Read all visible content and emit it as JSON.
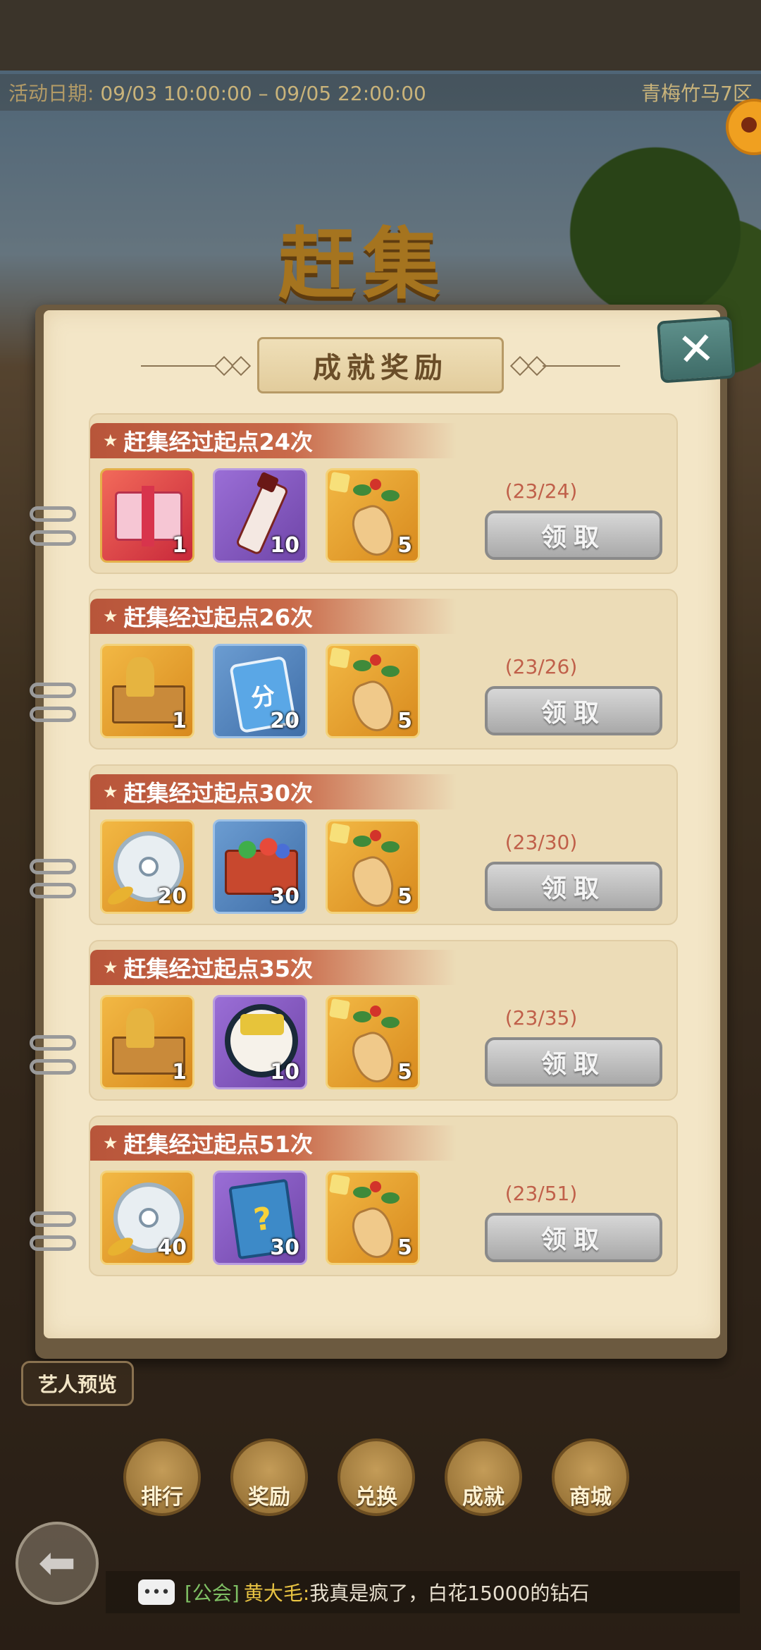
{
  "event": {
    "date_label": "活动日期:",
    "date_range": "09/03 10:00:00 – 09/05 22:00:00",
    "server": "青梅竹马7区",
    "title": "赶集"
  },
  "panel": {
    "header": "成就奖励",
    "close_label": "✕"
  },
  "achievements": [
    {
      "title": "赶集经过起点24次",
      "progress": "(23/24)",
      "claim_label": "领取",
      "rewards": [
        {
          "icon": "gift-box-icon",
          "qty": "1"
        },
        {
          "icon": "tonic-bottle-icon",
          "qty": "10"
        },
        {
          "icon": "ginseng-icon",
          "qty": "5"
        }
      ]
    },
    {
      "title": "赶集经过起点26次",
      "progress": "(23/26)",
      "claim_label": "领取",
      "rewards": [
        {
          "icon": "trophy-box-icon",
          "qty": "1"
        },
        {
          "icon": "score-card-icon",
          "qty": "20",
          "label": "分"
        },
        {
          "icon": "ginseng-icon",
          "qty": "5"
        }
      ]
    },
    {
      "title": "赶集经过起点30次",
      "progress": "(23/30)",
      "claim_label": "领取",
      "rewards": [
        {
          "icon": "jade-pendant-icon",
          "qty": "20"
        },
        {
          "icon": "treasure-chest-icon",
          "qty": "30"
        },
        {
          "icon": "ginseng-icon",
          "qty": "5"
        }
      ]
    },
    {
      "title": "赶集经过起点35次",
      "progress": "(23/35)",
      "claim_label": "领取",
      "rewards": [
        {
          "icon": "trophy-box-icon",
          "qty": "1"
        },
        {
          "icon": "cream-jar-icon",
          "qty": "10"
        },
        {
          "icon": "ginseng-icon",
          "qty": "5"
        }
      ]
    },
    {
      "title": "赶集经过起点51次",
      "progress": "(23/51)",
      "claim_label": "领取",
      "rewards": [
        {
          "icon": "jade-pendant-icon",
          "qty": "40"
        },
        {
          "icon": "mystery-notebook-icon",
          "qty": "30",
          "label": "?"
        },
        {
          "icon": "ginseng-icon",
          "qty": "5"
        }
      ]
    }
  ],
  "bottom_menu": {
    "preview": "艺人预览",
    "items": [
      "排行",
      "奖励",
      "兑换",
      "成就",
      "商城"
    ]
  },
  "chat": {
    "icon": "chat-bubble-icon",
    "channel": "[公会]",
    "user": "黄大毛:",
    "message": "我真是疯了，白花15000的钻石"
  },
  "colors": {
    "paper": "#f3e6c7",
    "title_ribbon": "#b8553a",
    "progress_text": "#c0604a",
    "claim_disabled": "#a9a9a9",
    "close_button": "#4f7f7a"
  }
}
